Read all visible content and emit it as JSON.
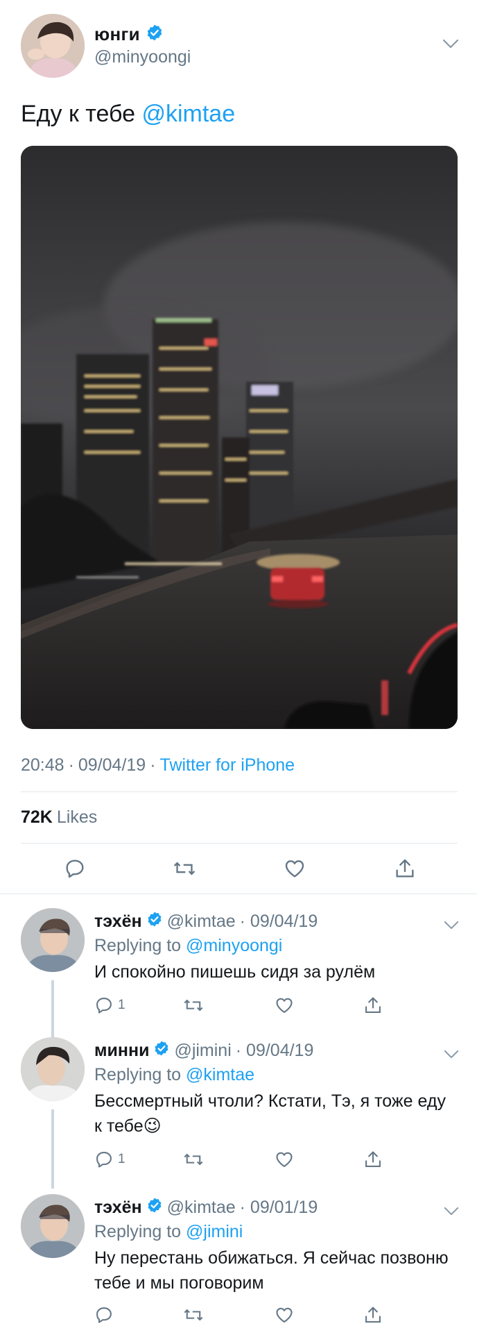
{
  "main_tweet": {
    "author_name": "юнги",
    "author_handle": "@minyoongi",
    "text_plain": "Еду к тебе ",
    "text_mention": "@kimtae",
    "time": "20:48",
    "date": "09/04/19",
    "separator": "·",
    "source": "Twitter for iPhone",
    "likes_count": "72K",
    "likes_label": "Likes",
    "icons": [
      "reply-icon",
      "retweet-icon",
      "like-icon",
      "share-icon"
    ]
  },
  "replies": [
    {
      "author_name": "тэхён",
      "author_handle": "@kimtae",
      "date_text": "· 09/04/19",
      "replying_label": "Replying to ",
      "replying_to": "@minyoongi",
      "text": "И спокойно пишешь сидя за рулём",
      "reply_count": "1"
    },
    {
      "author_name": "минни",
      "author_handle": "@jimini",
      "date_text": "· 09/04/19",
      "replying_label": "Replying to ",
      "replying_to": "@kimtae",
      "text": "Бессмертный чтоли? Кстати, Тэ, я тоже еду к тебе😉",
      "reply_count": "1"
    },
    {
      "author_name": "тэхён",
      "author_handle": "@kimtae",
      "date_text": "· 09/01/19",
      "replying_label": "Replying to ",
      "replying_to": "@jimini",
      "text": "Ну перестань обижаться. Я сейчас позвоню тебе и мы поговорим",
      "reply_count": ""
    }
  ],
  "colors": {
    "accent": "#1da1f2",
    "secondary_text": "#657786",
    "divider": "#e1e8ed",
    "thread_line": "#ccd6dd"
  }
}
